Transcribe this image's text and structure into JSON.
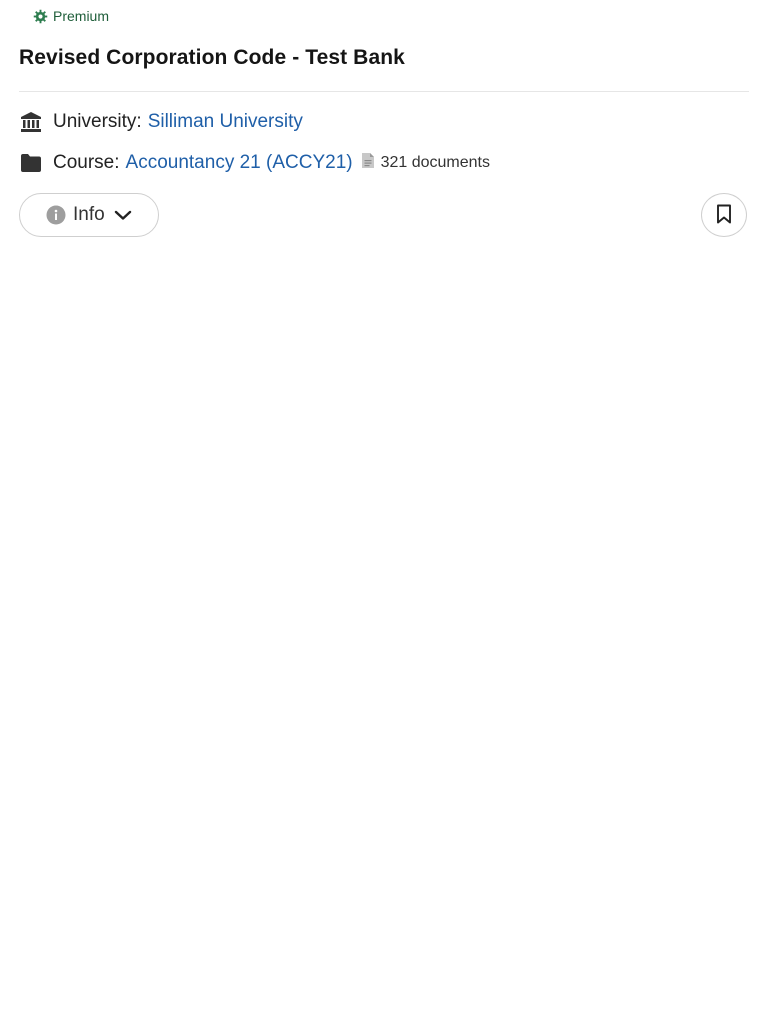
{
  "badge": {
    "label": "Premium",
    "icon": "premium-gear-icon",
    "color": "#1f5e3a"
  },
  "document": {
    "title": "Revised Corporation Code - Test Bank"
  },
  "university": {
    "icon": "university-building-icon",
    "label": "University:",
    "name": "Silliman University"
  },
  "course": {
    "icon": "folder-icon",
    "label": "Course:",
    "name": "Accountancy 21 (ACCY21)",
    "doc_icon": "document-icon",
    "document_count": "321 documents"
  },
  "actions": {
    "info_label": "Info",
    "info_icon": "info-icon",
    "chevron_icon": "chevron-down-icon",
    "bookmark_icon": "bookmark-icon"
  },
  "colors": {
    "link": "#1f5fa8",
    "premium": "#1f5e3a",
    "border": "#cfcfcf"
  }
}
